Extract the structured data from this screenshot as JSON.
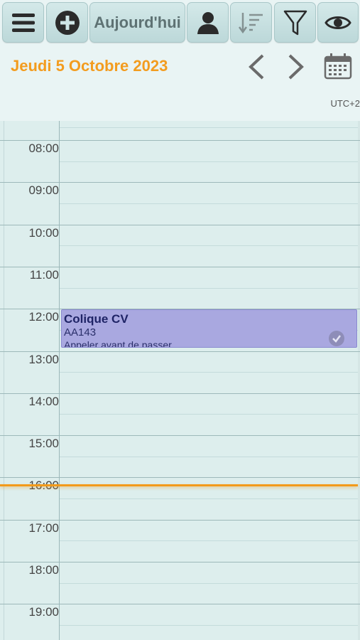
{
  "toolbar": {
    "menu_icon": "hamburger-menu-icon",
    "add_icon": "plus-circle-icon",
    "today_label": "Aujourd'hui",
    "user_icon": "person-icon",
    "sort_icon": "sort-descending-icon",
    "filter_icon": "funnel-icon",
    "view_icon": "eye-icon"
  },
  "header": {
    "date": "Jeudi 5 Octobre 2023",
    "prev_icon": "chevron-left-icon",
    "next_icon": "chevron-right-icon",
    "calendar_icon": "calendar-icon",
    "timezone": "UTC+2"
  },
  "hours": [
    "08:00",
    "09:00",
    "10:00",
    "11:00",
    "12:00",
    "13:00",
    "14:00",
    "15:00",
    "16:00",
    "17:00",
    "18:00",
    "19:00"
  ],
  "event": {
    "title": "Colique CV",
    "code": "AA143",
    "note": "Appeler avant de passer",
    "status_icon": "check-circle-icon",
    "start": "12:00",
    "end": "13:00"
  },
  "now_time": "16:00",
  "colors": {
    "accent": "#f39c1f",
    "event_bg": "#a9a8e0",
    "toolbar_bg": "#c8e1e2",
    "grid_bg": "#ddeeed"
  }
}
